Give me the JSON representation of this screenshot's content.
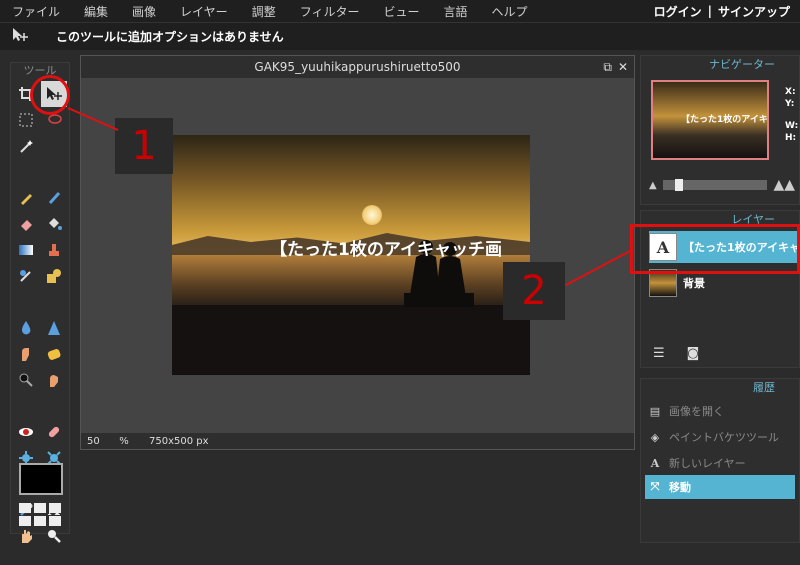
{
  "menu": [
    "ファイル",
    "編集",
    "画像",
    "レイヤー",
    "調整",
    "フィルター",
    "ビュー",
    "言語",
    "ヘルプ"
  ],
  "auth": {
    "login": "ログイン",
    "separator": "|",
    "signup": "サインアップ"
  },
  "options_bar": {
    "tool_icon": "move-tool-icon",
    "message": "このツールに追加オプションはありません"
  },
  "tools_panel": {
    "title": "ツール"
  },
  "document": {
    "title": "GAK95_yuuhikappurushiruetto500",
    "zoom": "50",
    "zoom_unit": "%",
    "dimensions": "750x500 px",
    "image_caption": "【たった1枚のアイキャッチ画"
  },
  "navigator": {
    "title": "ナビゲーター",
    "thumb_caption": "【たった1枚のアイキャ",
    "x_label": "X:",
    "y_label": "Y:",
    "w_label": "W:",
    "h_label": "H:"
  },
  "layers": {
    "title": "レイヤー",
    "items": [
      {
        "name": "【たった1枚のアイキャ",
        "selected": true
      },
      {
        "name": "背景",
        "selected": false
      }
    ]
  },
  "history": {
    "title": "履歴",
    "items": [
      {
        "label": "画像を開く",
        "selected": false
      },
      {
        "label": "ペイントバケツツール",
        "selected": false
      },
      {
        "label": "新しいレイヤー",
        "selected": false
      },
      {
        "label": "移動",
        "selected": true
      }
    ]
  },
  "annotations": {
    "one": "1",
    "two": "2"
  },
  "colors": {
    "accent": "#56b4d3",
    "highlight": "#e01010"
  }
}
